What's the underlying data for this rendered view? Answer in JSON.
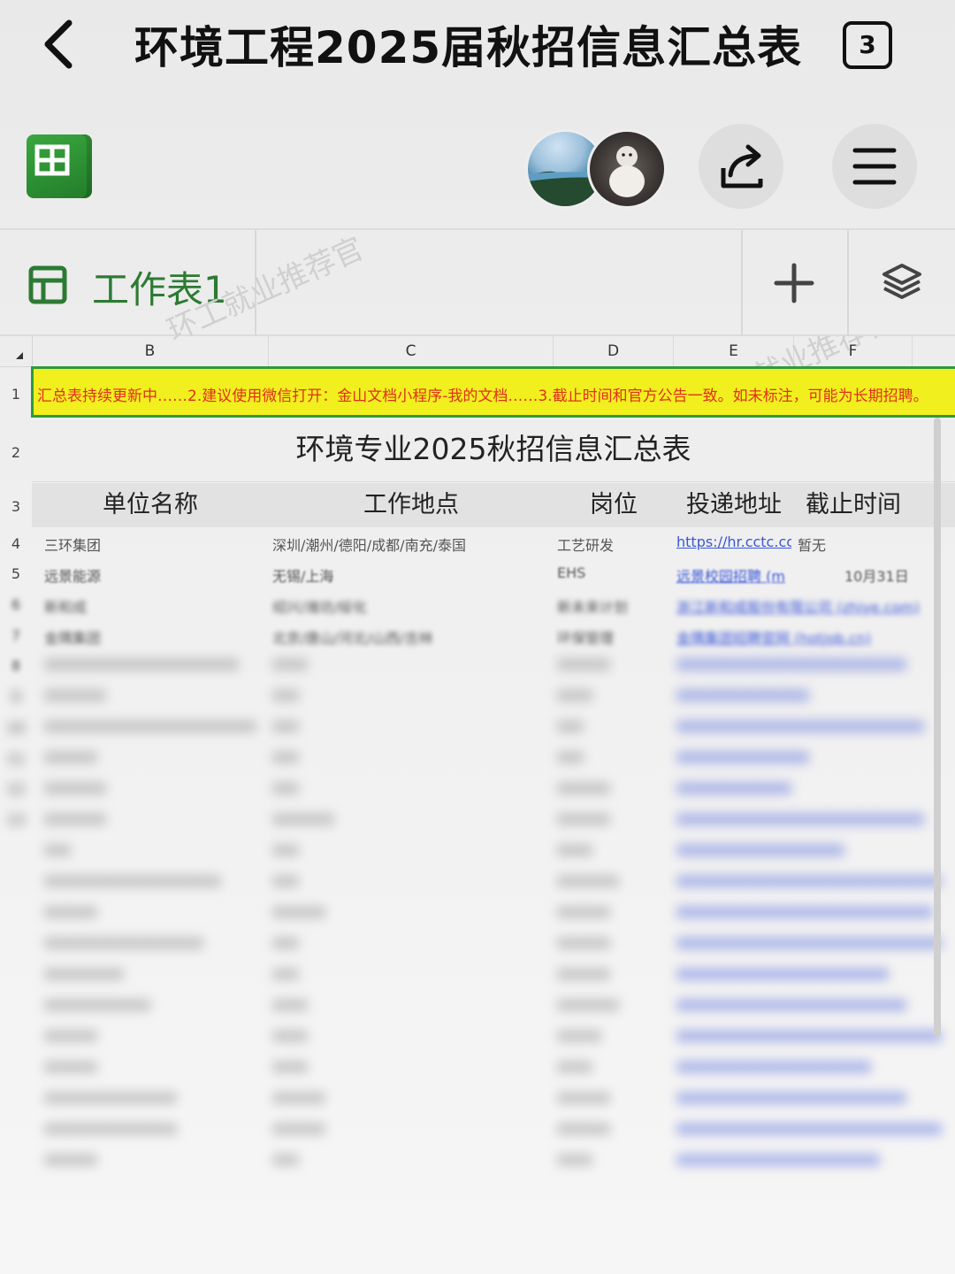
{
  "header": {
    "title": "环境工程2025届秋招信息汇总表",
    "tab_count": "3"
  },
  "sheet_tabs": [
    {
      "label": "工作表1"
    }
  ],
  "watermark": "环工就业推荐官",
  "columns": [
    "B",
    "C",
    "D",
    "E",
    "F"
  ],
  "rows_numbers": [
    "1",
    "2",
    "3",
    "4",
    "5",
    "6",
    "7",
    "8",
    "9",
    "10",
    "11",
    "12",
    "13"
  ],
  "notice": "汇总表持续更新中……2.建议使用微信打开：金山文档小程序-我的文档……3.截止时间和官方公告一致。如未标注，可能为长期招聘。",
  "sheet_title": "环境专业2025秋招信息汇总表",
  "table_headers": [
    "单位名称",
    "工作地点",
    "岗位",
    "投递地址",
    "截止时间"
  ],
  "table_rows": [
    {
      "company": "三环集团",
      "location": "深圳/潮州/德阳/成都/南充/泰国",
      "position": "工艺研发",
      "url": "https://hr.cctc.cc",
      "deadline": "暂无"
    },
    {
      "company": "远景能源",
      "location": "无锡/上海",
      "position": "EHS",
      "url": "远景校园招聘 (m",
      "deadline": "10月31日"
    },
    {
      "company": "新和成",
      "location": "绍兴/潍坊/绥化",
      "position": "新未来计划",
      "url": "浙江新和成股份有限公司 (zhiye.com)",
      "deadline": ""
    },
    {
      "company": "金隅集团",
      "location": "北京/唐山/河北/山西/吉林",
      "position": "环保管理",
      "url": "金隅集团招聘官网 (hotjob.cn)",
      "deadline": ""
    }
  ],
  "colors": {
    "accent_green": "#2d7a33",
    "notice_bg": "#f2ef1e",
    "notice_text": "#e0301e",
    "link": "#3a56d8"
  }
}
